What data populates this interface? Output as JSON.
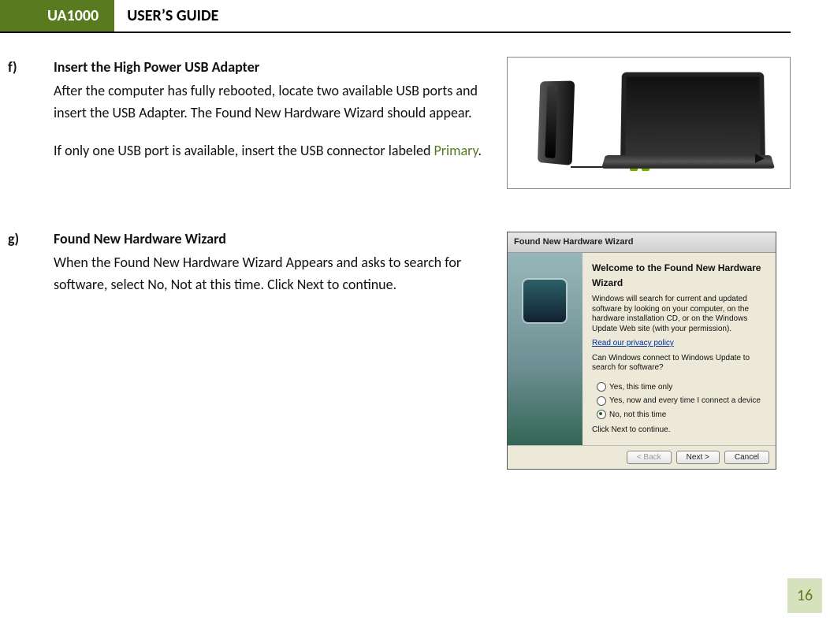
{
  "header": {
    "badge": "UA1000",
    "title": "USER’S GUIDE"
  },
  "sections": {
    "f": {
      "marker": "f)",
      "heading": "Insert the High Power USB Adapter",
      "para1": "After the computer has fully rebooted, locate two available USB ports and insert the USB Adapter. The Found New Hardware Wizard should appear.",
      "para2a": "If only one USB port is available, insert the USB connector labeled ",
      "para2_accent": "Primary",
      "para2b": "."
    },
    "g": {
      "marker": "g)",
      "heading": "Found New Hardware Wizard",
      "para1": "When the Found New Hardware Wizard Appears and asks to search for software, select No, Not at this time. Click Next to continue."
    }
  },
  "wizard": {
    "window_title": "Found New Hardware Wizard",
    "welcome": "Welcome to the Found New Hardware Wizard",
    "intro": "Windows will search for current and updated software by looking on your computer, on the hardware installation CD, or on the Windows Update Web site (with your permission).",
    "privacy_link": "Read our privacy policy",
    "question": "Can Windows connect to Windows Update to search for software?",
    "options": {
      "opt1": "Yes, this time only",
      "opt2": "Yes, now and every time I connect a device",
      "opt3": "No, not this time"
    },
    "click_next": "Click Next to continue.",
    "buttons": {
      "back": "< Back",
      "next": "Next >",
      "cancel": "Cancel"
    }
  },
  "page_number": "16"
}
